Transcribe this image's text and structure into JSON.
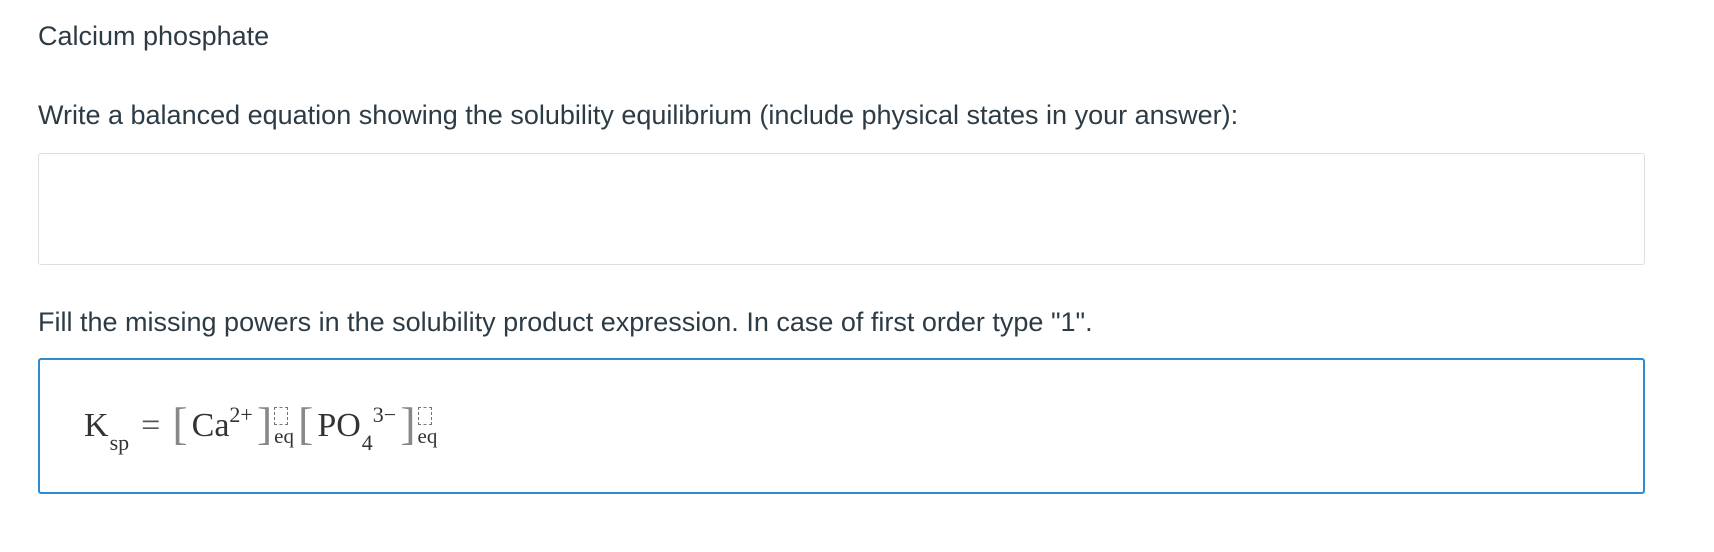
{
  "title": "Calcium phosphate",
  "question1": {
    "prompt": "Write a balanced equation showing the solubility equilibrium (include physical states in your answer):",
    "answer_value": ""
  },
  "question2": {
    "prompt": "Fill the missing powers in the solubility product expression. In case of first order type \"1\".",
    "expression": {
      "lhs_symbol": "K",
      "lhs_subscript": "sp",
      "equals": "=",
      "term1_species": "Ca",
      "term1_charge": "2+",
      "term1_eq": "eq",
      "term1_power_value": "",
      "term2_species": "PO",
      "term2_subscript": "4",
      "term2_charge": "3−",
      "term2_eq": "eq",
      "term2_power_value": ""
    }
  },
  "colors": {
    "text": "#2d3b45",
    "focus_border": "#2f8bd1",
    "box_border": "#dcdfe2"
  }
}
